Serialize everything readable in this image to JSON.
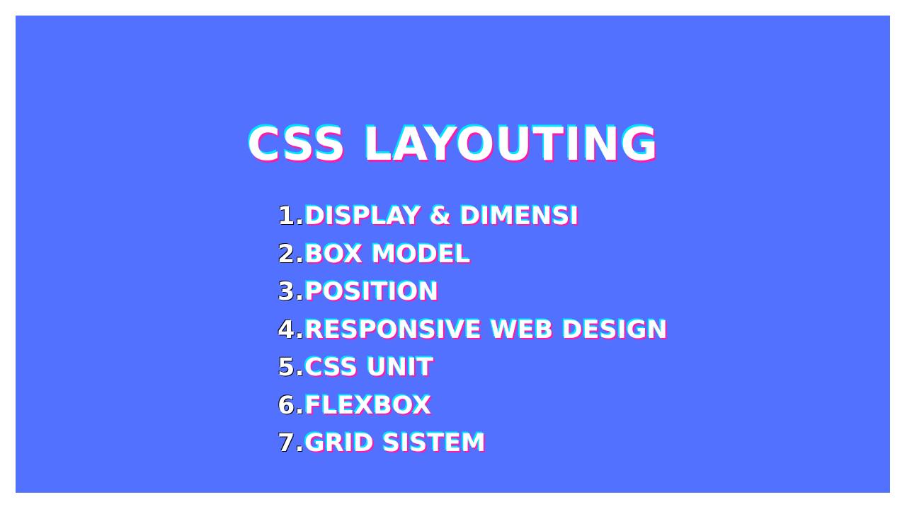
{
  "slide": {
    "title": "CSS LAYOUTING",
    "background_color": "#5271ff",
    "accent_colors": [
      "#00e5ff",
      "#ff1aa6"
    ],
    "topics": [
      {
        "number": "1.",
        "label": "DISPLAY & DIMENSI"
      },
      {
        "number": "2.",
        "label": "BOX MODEL"
      },
      {
        "number": "3.",
        "label": "POSITION"
      },
      {
        "number": "4.",
        "label": "RESPONSIVE WEB DESIGN"
      },
      {
        "number": "5.",
        "label": "CSS UNIT"
      },
      {
        "number": "6.",
        "label": "FLEXBOX"
      },
      {
        "number": "7.",
        "label": "GRID SISTEM"
      }
    ]
  }
}
